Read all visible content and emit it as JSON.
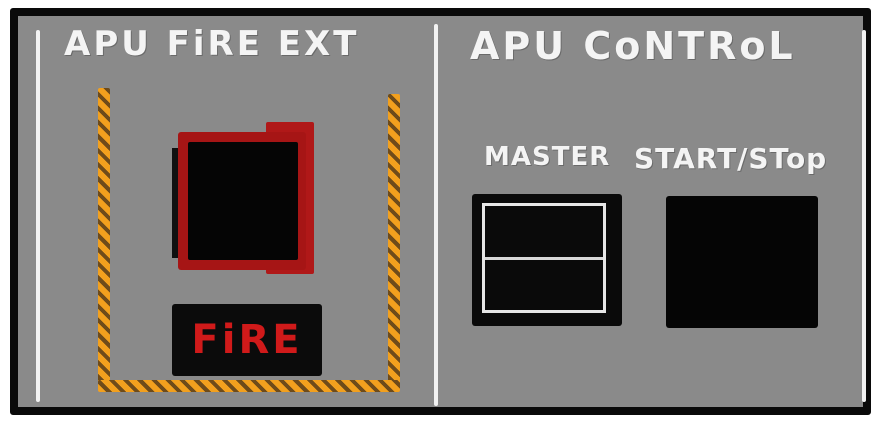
{
  "panel": {
    "colors": {
      "panel": "#8a8a8a",
      "frame": "#0a0a0a",
      "label": "#f4f4f4",
      "guard_stripe": "#f2a01e",
      "fire_red": "#a61515",
      "fire_text": "#d01a1a"
    }
  },
  "fire_ext": {
    "title": "APU FiRE EXT",
    "handle_icon": "fire-handle",
    "warning_light_label": "FiRE"
  },
  "apu_control": {
    "title": "APU CoNTRoL",
    "master_label": "MASTER",
    "start_stop_label": "START/STop"
  }
}
